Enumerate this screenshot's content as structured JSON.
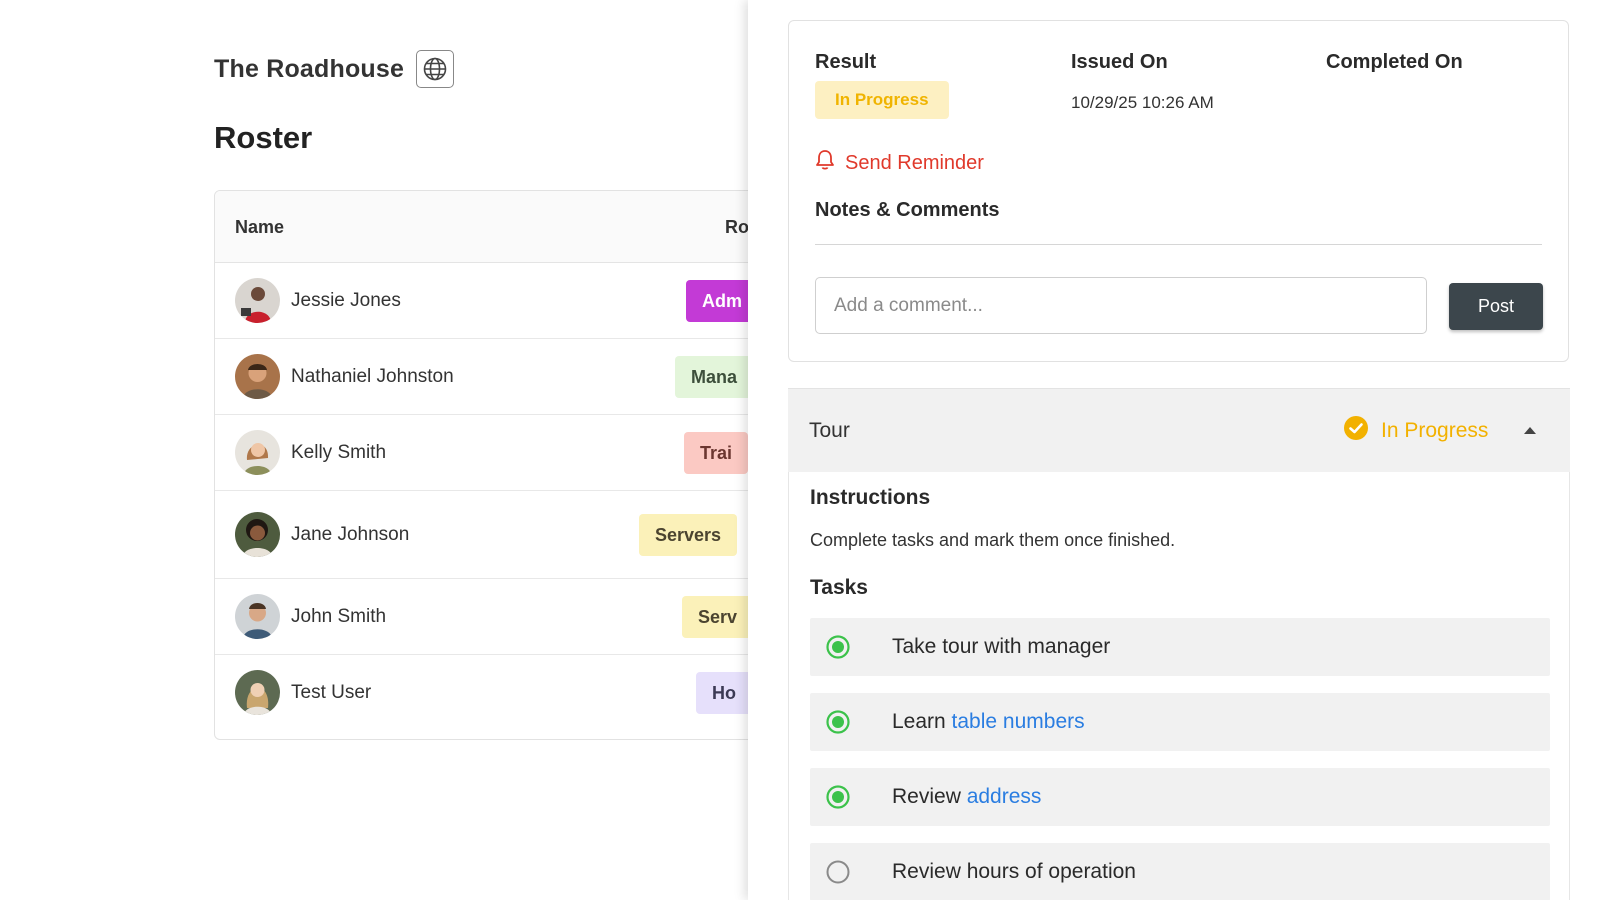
{
  "org": {
    "name": "The Roadhouse",
    "globe_icon": "globe-icon"
  },
  "roster": {
    "title": "Roster",
    "columns": {
      "name": "Name",
      "role": "Ro"
    },
    "rows": [
      {
        "name": "Jessie Jones",
        "role": "Adm",
        "role_bg": "#c33ad6",
        "role_fg": "#ffffff"
      },
      {
        "name": "Nathaniel Johnston",
        "role": "Mana",
        "role_bg": "#e3f5da",
        "role_fg": "#3d4f3b"
      },
      {
        "name": "Kelly Smith",
        "role": "Trai",
        "role_bg": "#fbc9c3",
        "role_fg": "#6b3630"
      },
      {
        "name": "Jane Johnson",
        "role": "Servers",
        "role_bg": "#fbf1b9",
        "role_fg": "#4b4430"
      },
      {
        "name": "John Smith",
        "role": "Serv",
        "role_bg": "#fbf1b9",
        "role_fg": "#4b4430"
      },
      {
        "name": "Test User",
        "role": "Ho",
        "role_bg": "#e6e0fb",
        "role_fg": "#3c3a55"
      }
    ]
  },
  "drawer": {
    "labels": {
      "result": "Result",
      "issued_on": "Issued On",
      "completed_on": "Completed On"
    },
    "result_status": "In Progress",
    "issued_on_value": "10/29/25 10:26 AM",
    "send_reminder": "Send Reminder",
    "notes_title": "Notes & Comments",
    "comment_placeholder": "Add a comment...",
    "post_label": "Post",
    "colors": {
      "accent_yellow": "#f2b100",
      "reminder_red": "#e0392b",
      "task_green": "#3cc24b",
      "link_blue": "#2a7de1"
    }
  },
  "tour": {
    "title": "Tour",
    "status": "In Progress",
    "instructions_title": "Instructions",
    "instructions_text": "Complete tasks and mark them once finished.",
    "tasks_title": "Tasks",
    "tasks": [
      {
        "text": "Take tour with manager",
        "link": "",
        "done": true
      },
      {
        "text": "Learn ",
        "link": "table numbers",
        "done": true
      },
      {
        "text": "Review ",
        "link": "address",
        "done": true
      },
      {
        "text": "Review hours of operation",
        "link": "",
        "done": false
      }
    ]
  }
}
